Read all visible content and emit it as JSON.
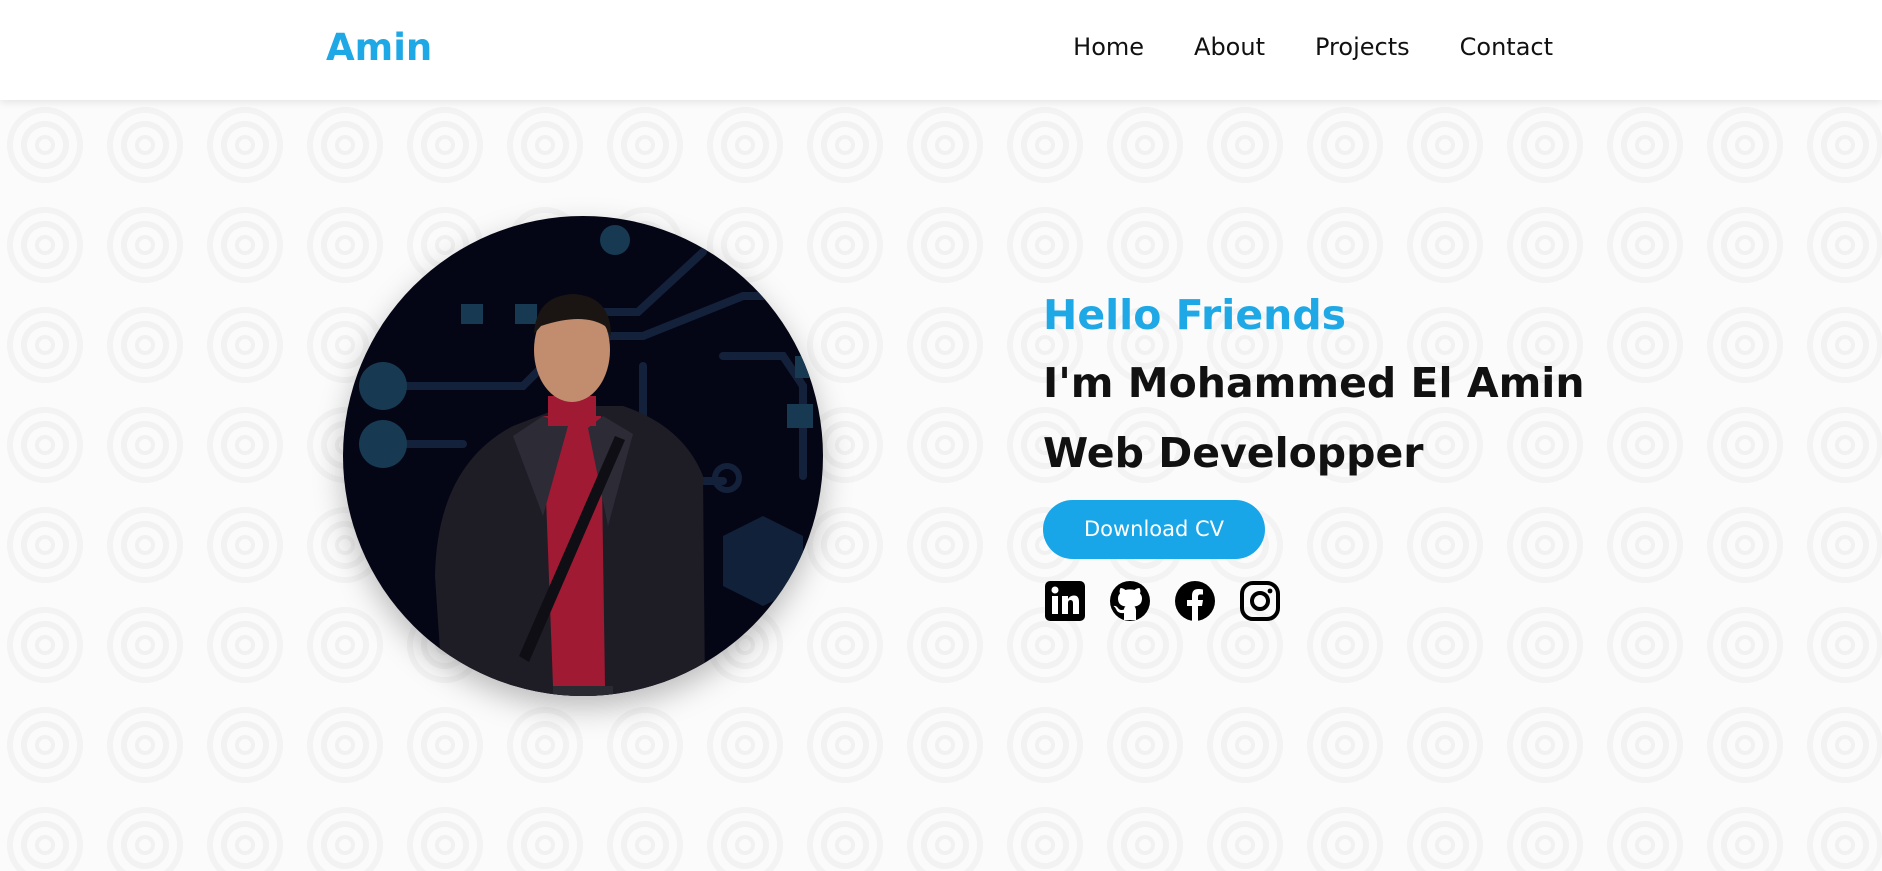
{
  "nav": {
    "brand": "Amin",
    "links": [
      {
        "label": "Home"
      },
      {
        "label": "About"
      },
      {
        "label": "Projects"
      },
      {
        "label": "Contact"
      }
    ]
  },
  "hero": {
    "greeting": "Hello Friends",
    "name": "I'm Mohammed El Amin",
    "role": "Web Developper",
    "cv_button": "Download CV",
    "photo_alt": "Portrait of Mohammed El Amin",
    "socials": [
      {
        "icon": "linkedin-icon"
      },
      {
        "icon": "github-icon"
      },
      {
        "icon": "facebook-icon"
      },
      {
        "icon": "instagram-icon"
      }
    ]
  },
  "colors": {
    "accent": "#1ea8e6",
    "button": "#19a6e8",
    "text": "#111111",
    "navbar_bg": "#ffffff",
    "photo_bg": "#050615"
  }
}
